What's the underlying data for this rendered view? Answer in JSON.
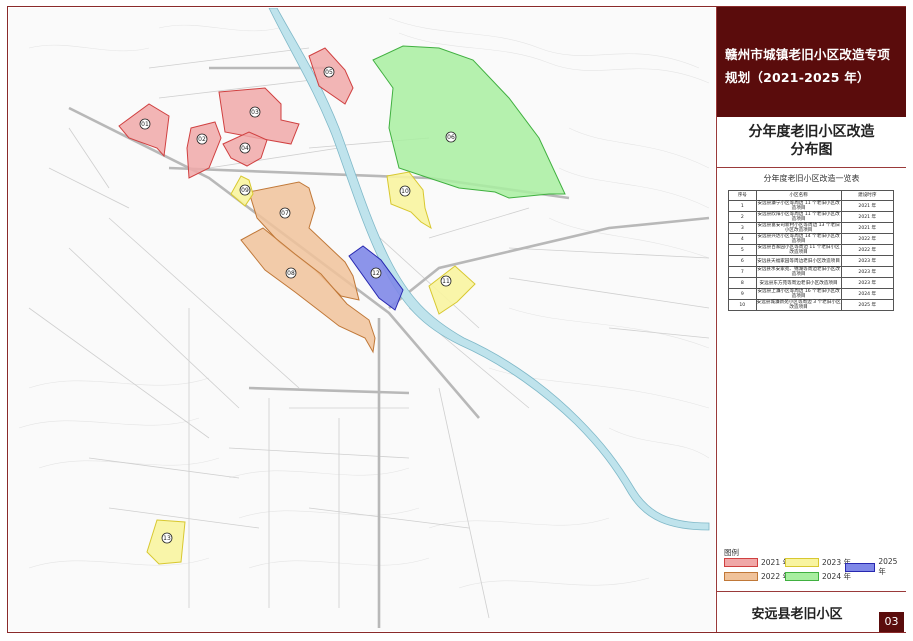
{
  "header": {
    "title": "赣州市城镇老旧小区改造专项规划（2021-2025 年）",
    "subtitle_line1": "分年度老旧小区改造",
    "subtitle_line2": "分布图"
  },
  "table": {
    "title": "分年度老旧小区改造一览表",
    "headers": [
      "序号",
      "小区名称",
      "建设时序"
    ],
    "rows": [
      {
        "no": "1",
        "name": "安远县濂宁小区等周边 11 个老旧小区改造项目",
        "year": "2021 年"
      },
      {
        "no": "2",
        "name": "安远县欣阳小区等周边 11 个老旧小区改造项目",
        "year": "2021 年"
      },
      {
        "no": "3",
        "name": "安远县富安司新村小区等周边 13 个老旧小区改造项目",
        "year": "2021 年"
      },
      {
        "no": "4",
        "name": "安远县兴达小区等周边 14 个老旧小区改造项目",
        "year": "2022 年"
      },
      {
        "no": "5",
        "name": "安远县百家园小区等周边 11 个老旧小区改造项目",
        "year": "2022 年"
      },
      {
        "no": "6",
        "name": "安远县天福家园等周边老旧小区改造项目",
        "year": "2023 年"
      },
      {
        "no": "7",
        "name": "安远县水安家苑、锦湖等周边老旧小区改造项目",
        "year": "2023 年"
      },
      {
        "no": "8",
        "name": "安远县东方苑等周边老旧小区改造项目",
        "year": "2023 年"
      },
      {
        "no": "9",
        "name": "安远县上濂小区等周边 16 个老旧小区改造项目",
        "year": "2024 年"
      },
      {
        "no": "10",
        "name": "安远县城濂新苑小区等周边 3 个老旧小区改造项目",
        "year": "2025 年"
      }
    ]
  },
  "legend": {
    "title": "图例",
    "items": [
      {
        "label": "2021 年",
        "fill": "#f0a8a8",
        "stroke": "#d04040"
      },
      {
        "label": "2023 年",
        "fill": "#f8f4a0",
        "stroke": "#d8c830"
      },
      {
        "label": "2025 年",
        "fill": "#7f88e8",
        "stroke": "#2828b0"
      },
      {
        "label": "2022 年",
        "fill": "#f0c29a",
        "stroke": "#c07838"
      },
      {
        "label": "2024 年",
        "fill": "#a8eea0",
        "stroke": "#40b040"
      }
    ]
  },
  "map": {
    "zones": [
      {
        "id": "zone-01",
        "label": "01",
        "year": "2021 年"
      },
      {
        "id": "zone-02",
        "label": "02",
        "year": "2021 年"
      },
      {
        "id": "zone-03",
        "label": "03",
        "year": "2021 年"
      },
      {
        "id": "zone-04",
        "label": "04",
        "year": "2021 年"
      },
      {
        "id": "zone-05",
        "label": "05",
        "year": "2021 年"
      },
      {
        "id": "zone-06",
        "label": "06",
        "year": "2024 年"
      },
      {
        "id": "zone-07",
        "label": "07",
        "year": "2022 年"
      },
      {
        "id": "zone-08",
        "label": "08",
        "year": "2022 年"
      },
      {
        "id": "zone-09",
        "label": "09",
        "year": "2023 年"
      },
      {
        "id": "zone-10",
        "label": "10",
        "year": "2023 年"
      },
      {
        "id": "zone-11",
        "label": "11",
        "year": "2023 年"
      },
      {
        "id": "zone-12",
        "label": "12",
        "year": "2025 年"
      },
      {
        "id": "zone-13",
        "label": "13",
        "year": "2023 年"
      }
    ]
  },
  "footer": {
    "label": "安远县老旧小区",
    "page": "03"
  }
}
